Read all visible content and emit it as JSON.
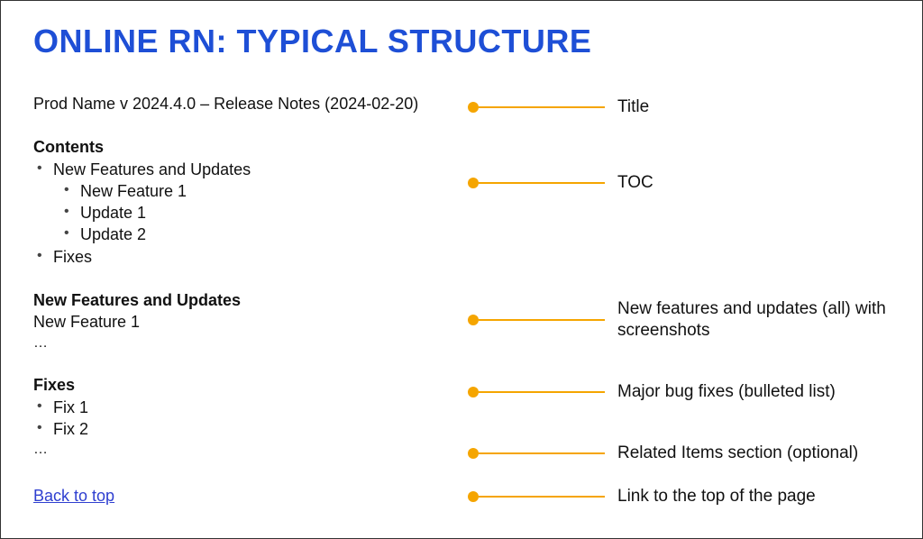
{
  "heading": "ONLINE RN: TYPICAL STRUCTURE",
  "sample": {
    "title_line": "Prod Name v 2024.4.0 – Release Notes (2024-02-20)",
    "toc": {
      "label": "Contents",
      "item1": "New Features and Updates",
      "item1a": "New Feature 1",
      "item1b": "Update 1",
      "item1c": "Update 2",
      "item2": "Fixes"
    },
    "features": {
      "heading": "New Features and Updates",
      "item": "New Feature 1",
      "ellipsis": "…"
    },
    "fixes": {
      "heading": "Fixes",
      "item1": "Fix 1",
      "item2": "Fix 2",
      "ellipsis": "…"
    },
    "back_link": "Back to top"
  },
  "annotations": {
    "title": "Title",
    "toc": "TOC",
    "features": "New features and updates (all) with screenshots",
    "fixes": "Major bug fixes (bulleted list)",
    "related": "Related Items section (optional)",
    "back": "Link to the top of the page"
  }
}
